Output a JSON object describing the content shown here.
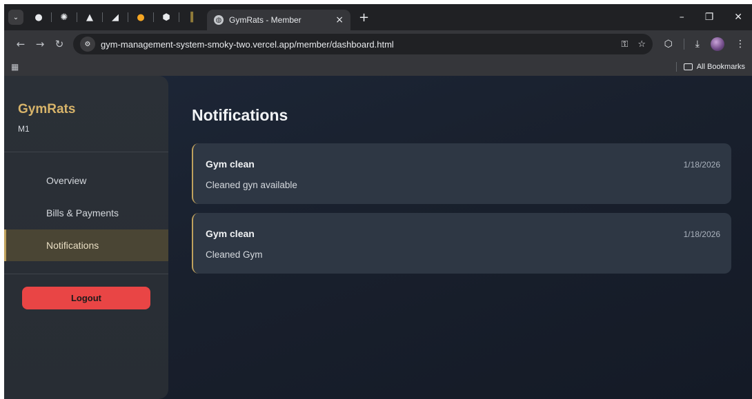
{
  "browser": {
    "tab_title": "GymRats - Member",
    "url": "gym-management-system-smoky-two.vercel.app/member/dashboard.html",
    "bookmarks_label": "All Bookmarks"
  },
  "sidebar": {
    "brand": "GymRats",
    "member_id": "M1",
    "nav": [
      {
        "label": "Overview",
        "active": false
      },
      {
        "label": "Bills & Payments",
        "active": false
      },
      {
        "label": "Notifications",
        "active": true
      }
    ],
    "logout_label": "Logout"
  },
  "main": {
    "title": "Notifications",
    "notifications": [
      {
        "title": "Gym clean",
        "body": "Cleaned gyn available",
        "date": "1/18/2026"
      },
      {
        "title": "Gym clean",
        "body": "Cleaned Gym",
        "date": "1/18/2026"
      }
    ]
  },
  "colors": {
    "accent_gold": "#d8b46a",
    "logout_red": "#e94545",
    "page_bg": "#19202d"
  }
}
